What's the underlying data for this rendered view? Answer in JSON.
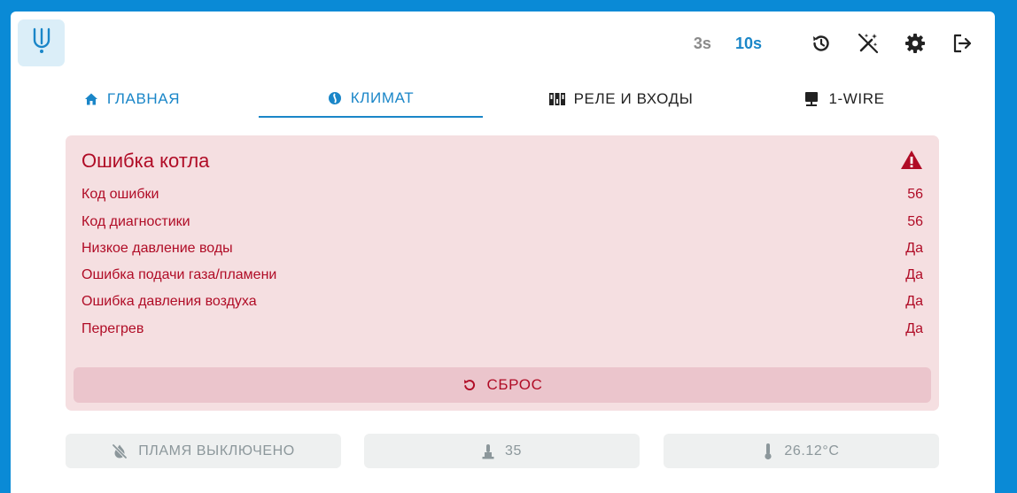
{
  "header": {
    "logo_icon": "tuning-fork-logo-icon",
    "intervals": [
      "3s",
      "10s"
    ],
    "active_interval": "10s",
    "icons": [
      "history-icon",
      "magic-wand-off-icon",
      "gear-icon",
      "logout-icon"
    ]
  },
  "tabs": [
    {
      "label": "ГЛАВНАЯ",
      "icon": "home-icon"
    },
    {
      "label": "КЛИМАТ",
      "icon": "climate-icon",
      "active": true
    },
    {
      "label": "РЕЛЕ И ВХОДЫ",
      "icon": "relay-icon"
    },
    {
      "label": "1-WIRE",
      "icon": "monitor-icon"
    }
  ],
  "error_card": {
    "title": "Ошибка котла",
    "rows": [
      {
        "label": "Код ошибки",
        "value": "56"
      },
      {
        "label": "Код диагностики",
        "value": "56"
      },
      {
        "label": "Низкое давление воды",
        "value": "Да"
      },
      {
        "label": "Ошибка подачи газа/пламени",
        "value": "Да"
      },
      {
        "label": "Ошибка давления воздуха",
        "value": "Да"
      },
      {
        "label": "Перегрев",
        "value": "Да"
      }
    ],
    "reset_label": "СБРОС"
  },
  "chips": [
    {
      "label": "ПЛАМЯ ВЫКЛЮЧЕНО",
      "icon": "fire-off-icon"
    },
    {
      "label": "35",
      "icon": "water-heater-icon"
    },
    {
      "label": "26.12°C",
      "icon": "thermometer-icon"
    }
  ],
  "colors": {
    "background": "#0a8ad6",
    "accent": "#1a86c8",
    "error_text": "#b00c26",
    "error_bg": "#f5dfe1",
    "chip_bg": "#eef0f0",
    "chip_text": "#8c979b"
  }
}
